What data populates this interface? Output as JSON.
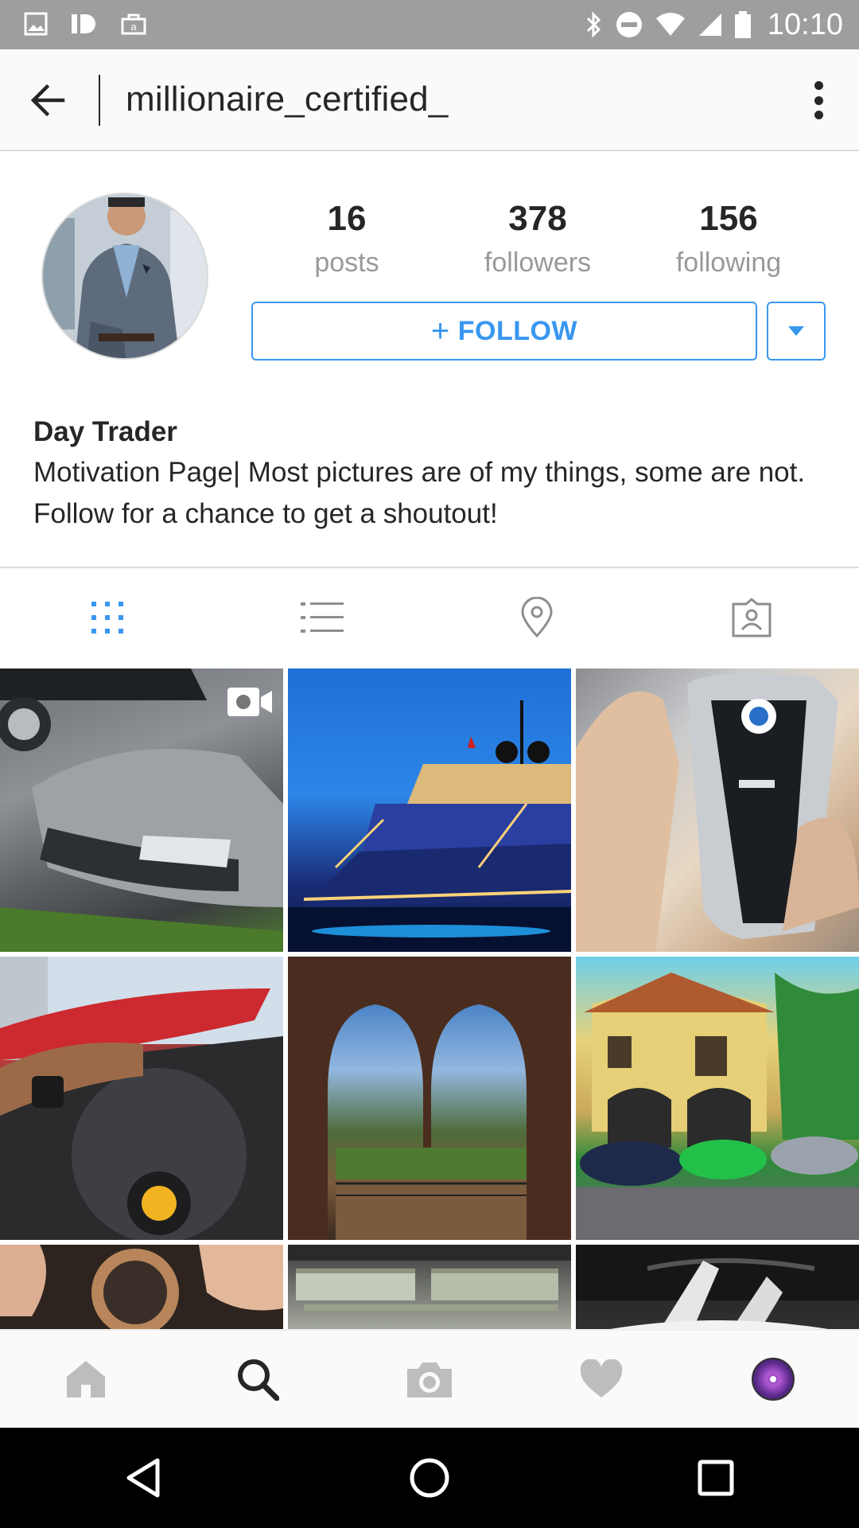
{
  "status_bar": {
    "time": "10:10",
    "left_icons": [
      "image-icon",
      "id-icon",
      "amazon-icon"
    ],
    "right_icons": [
      "bluetooth-icon",
      "do-not-disturb-icon",
      "wifi-icon",
      "signal-icon",
      "battery-icon"
    ]
  },
  "app_bar": {
    "username": "millionaire_certified_",
    "back_icon": "arrow-left-icon",
    "more_icon": "more-vertical-icon"
  },
  "profile": {
    "stats": [
      {
        "value": "16",
        "label": "posts"
      },
      {
        "value": "378",
        "label": "followers"
      },
      {
        "value": "156",
        "label": "following"
      }
    ],
    "follow_plus": "+",
    "follow_label": "FOLLOW",
    "name": "Day Trader",
    "bio": "Motivation Page| Most pictures are of my things, some are not. Follow for a chance to get a shoutout!"
  },
  "tabs": [
    {
      "icon": "grid-icon",
      "active": true
    },
    {
      "icon": "list-icon",
      "active": false
    },
    {
      "icon": "location-icon",
      "active": false
    },
    {
      "icon": "tagged-icon",
      "active": false
    }
  ],
  "posts": [
    {
      "subject": "silver sports car",
      "video": true
    },
    {
      "subject": "yacht at night",
      "video": false
    },
    {
      "subject": "BMW display key",
      "video": false
    },
    {
      "subject": "private jet and steering wheel",
      "video": false
    },
    {
      "subject": "terrace archway view",
      "video": false
    },
    {
      "subject": "mansion with supercars",
      "video": false
    },
    {
      "subject": "luxury watch",
      "video": false
    },
    {
      "subject": "stacks of cash",
      "video": false
    },
    {
      "subject": "Lamborghini",
      "video": false
    }
  ],
  "bottom_nav": [
    "home-icon",
    "search-icon",
    "camera-icon",
    "heart-icon",
    "profile-avatar"
  ],
  "system_nav": [
    "back-triangle-icon",
    "home-circle-icon",
    "recents-square-icon"
  ],
  "colors": {
    "accent": "#3897f0",
    "status_bar": "#9e9e9e",
    "text": "#262626",
    "muted": "#999999"
  }
}
